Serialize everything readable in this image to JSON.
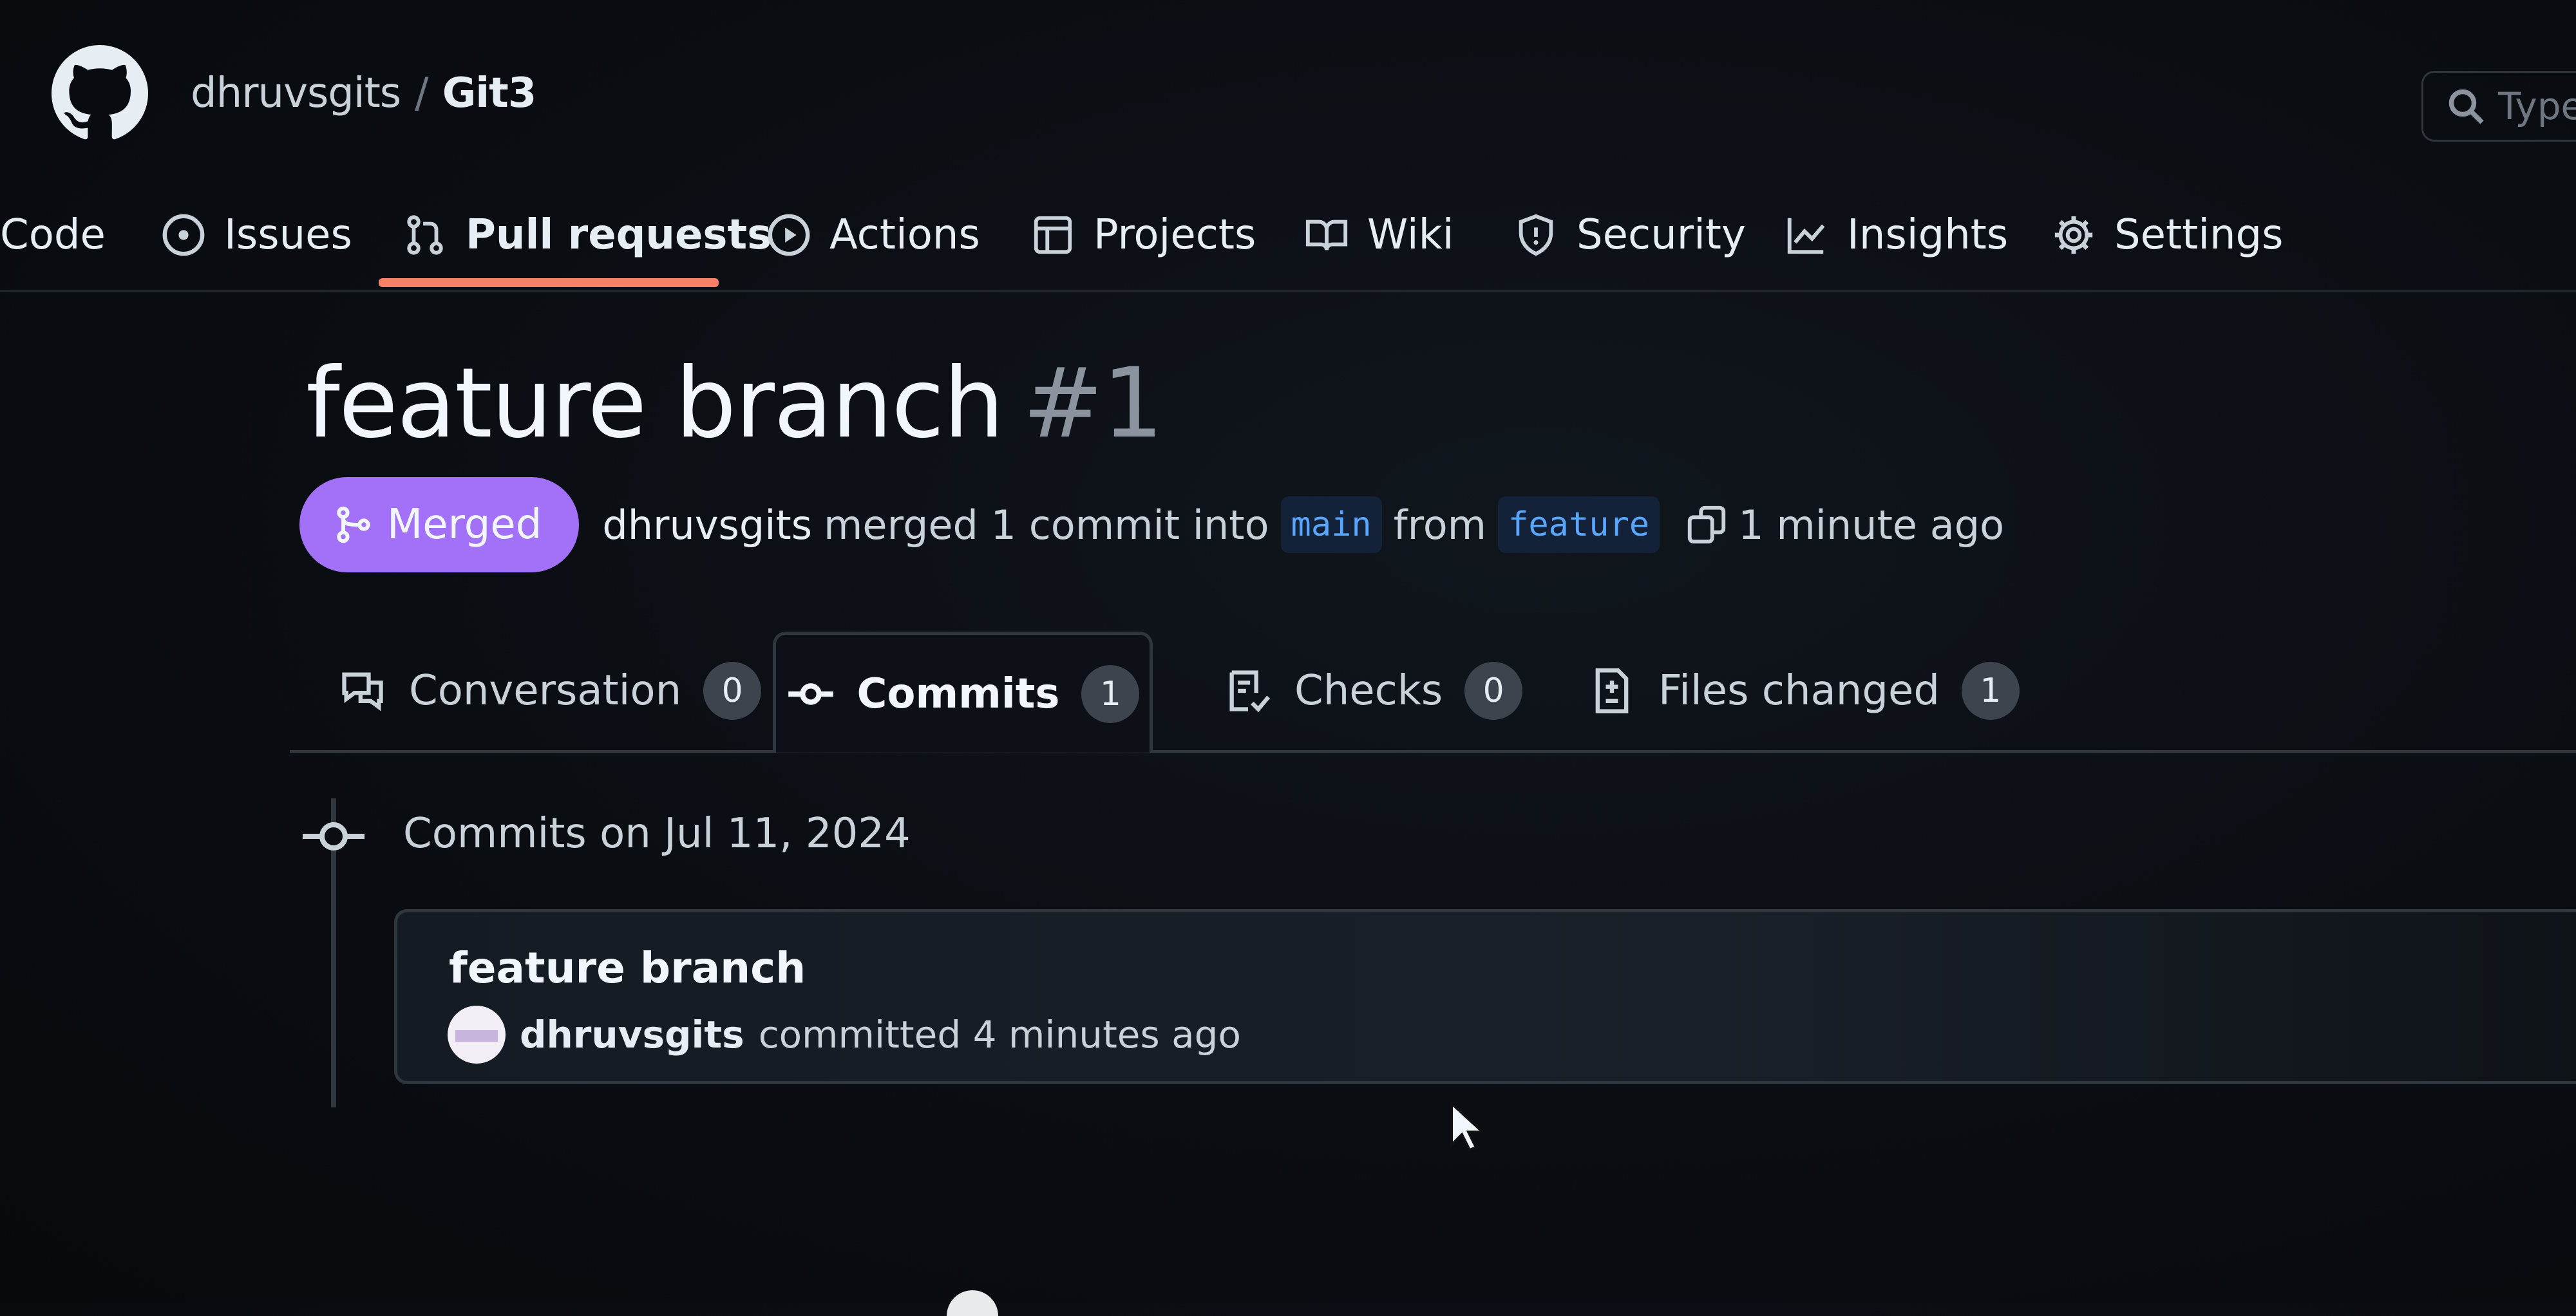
{
  "header": {
    "owner": "dhruvsgits",
    "separator": "/",
    "repo": "Git3",
    "search_placeholder": "Type"
  },
  "nav": {
    "code": "Code",
    "issues": "Issues",
    "pull_requests": "Pull requests",
    "actions": "Actions",
    "projects": "Projects",
    "wiki": "Wiki",
    "security": "Security",
    "insights": "Insights",
    "settings": "Settings"
  },
  "pr": {
    "title": "feature branch",
    "number": "#1",
    "status": "Merged",
    "author": "dhruvsgits",
    "action_text": "merged 1 commit into",
    "base_branch": "main",
    "from_text": "from",
    "head_branch": "feature",
    "time": "1 minute ago"
  },
  "tabs": {
    "conversation": {
      "label": "Conversation",
      "count": "0"
    },
    "commits": {
      "label": "Commits",
      "count": "1"
    },
    "checks": {
      "label": "Checks",
      "count": "0"
    },
    "files_changed": {
      "label": "Files changed",
      "count": "1"
    }
  },
  "commits": {
    "date_heading": "Commits on Jul 11, 2024",
    "items": [
      {
        "title": "feature branch",
        "author": "dhruvsgits",
        "meta": "committed 4 minutes ago"
      }
    ]
  },
  "colors": {
    "merged": "#a371f7",
    "active_tab": "#f78166",
    "branch_text": "#58a6ff"
  }
}
